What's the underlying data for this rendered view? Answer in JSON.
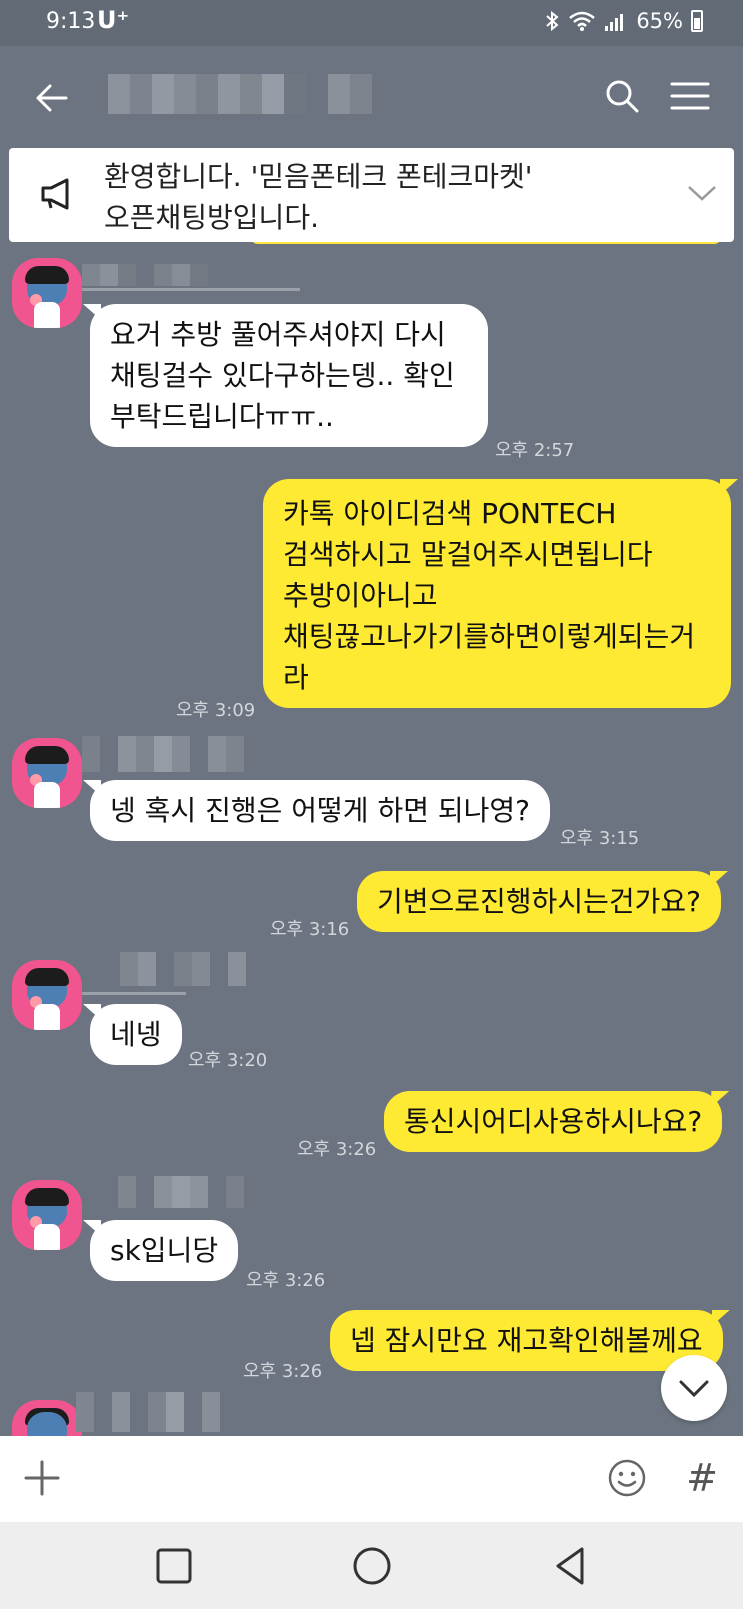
{
  "status_bar": {
    "time": "9:13",
    "carrier": "U⁺",
    "battery": "65%"
  },
  "header": {
    "title_blurred": true,
    "icons": [
      "back-arrow-icon",
      "search-icon",
      "menu-icon"
    ]
  },
  "notice": {
    "text": "환영합니다. '믿음폰테크 폰테크마켓'\n오픈채팅방입니다.",
    "icons": [
      "megaphone-icon",
      "chevron-down-icon"
    ]
  },
  "messages": [
    {
      "direction": "in",
      "text": "요거 추방 풀어주셔야지 다시\n채팅걸수 있다구하는뎅.. 확인\n부탁드립니다ㅠㅠ..",
      "time": "오후 2:57"
    },
    {
      "direction": "out",
      "text": "카톡 아이디검색 PONTECH\n검색하시고  말걸어주시면됩니다\n추방이아니고\n채팅끊고나가기를하면이렇게되는거\n라",
      "time": "오후 3:09"
    },
    {
      "direction": "in",
      "text": "넹 혹시 진행은 어떻게 하면 되나영?",
      "time": "오후 3:15"
    },
    {
      "direction": "out",
      "text": "기변으로진행하시는건가요?",
      "time": "오후 3:16"
    },
    {
      "direction": "in",
      "text": "네넹",
      "time": "오후 3:20"
    },
    {
      "direction": "out",
      "text": "통신시어디사용하시나요?",
      "time": "오후 3:26"
    },
    {
      "direction": "in",
      "text": "sk입니당",
      "time": "오후 3:26"
    },
    {
      "direction": "out",
      "text": "넵 잠시만요 재고확인해볼께요",
      "time": "오후 3:26"
    }
  ],
  "input_bar": {
    "placeholder": "",
    "icons": [
      "plus-icon",
      "emoji-icon",
      "hashtag-icon"
    ],
    "hashtag_label": "#"
  },
  "nav_bar": {
    "icons": [
      "recent-apps-icon",
      "home-icon",
      "back-icon"
    ]
  },
  "colors": {
    "background": "#6b7480",
    "outgoing_bubble": "#fee933",
    "incoming_bubble": "#ffffff",
    "avatar": "#f0558f"
  }
}
